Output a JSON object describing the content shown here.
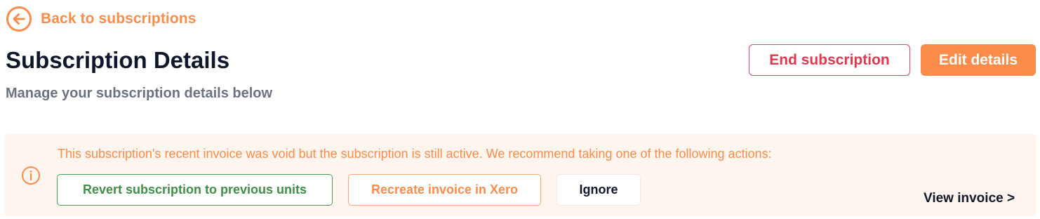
{
  "nav": {
    "back_label": "Back to subscriptions",
    "back_icon": "arrow-left-circle-icon"
  },
  "header": {
    "title": "Subscription Details",
    "subtitle": "Manage your subscription details below",
    "end_label": "End subscription",
    "edit_label": "Edit details"
  },
  "alert": {
    "icon": "info-circle-icon",
    "message": "This subscription's recent invoice was void but the subscription is still active. We recommend taking one of the following actions:",
    "actions": {
      "revert_label": "Revert subscription to previous units",
      "recreate_label": "Recreate invoice in Xero",
      "ignore_label": "Ignore"
    },
    "view_invoice_label": "View invoice >"
  },
  "colors": {
    "accent": "#fb8c4a",
    "danger": "#e3374f",
    "success": "#3f8f47",
    "alert_background": "#fff5ef",
    "title_text": "#0f172a",
    "muted_text": "#6b7280"
  }
}
